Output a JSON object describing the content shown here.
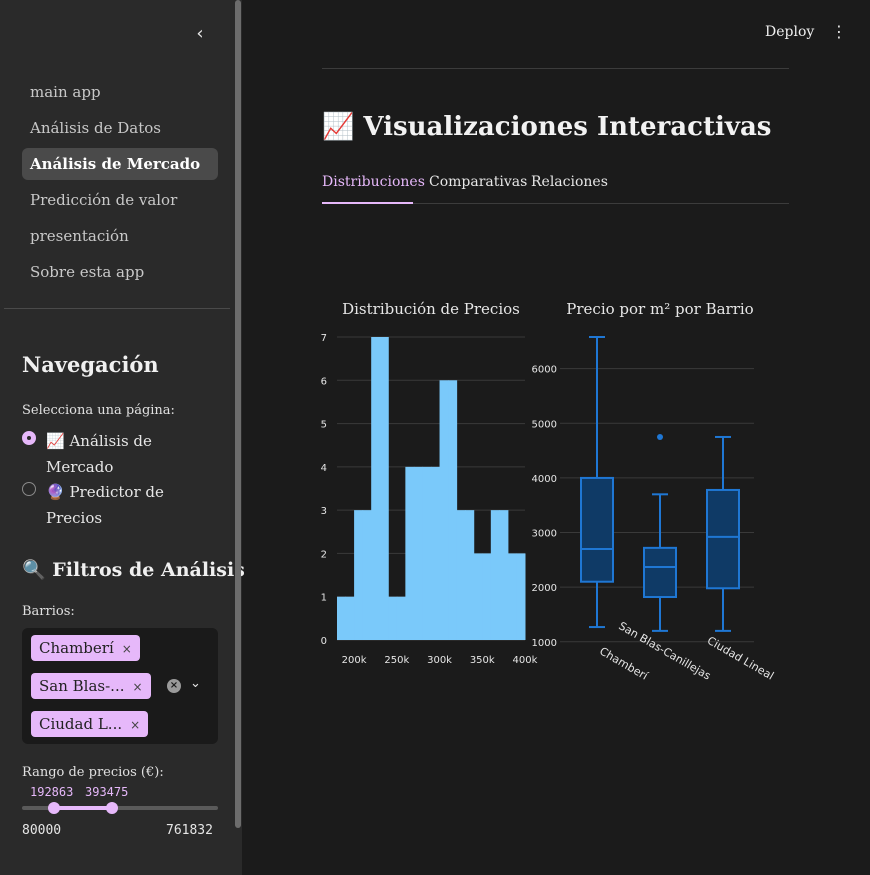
{
  "sidebar": {
    "collapse_icon": "chevron-left-icon",
    "collapse_glyph": "‹",
    "nav_links": [
      {
        "label": "main app"
      },
      {
        "label": "Análisis de Datos"
      },
      {
        "label": "Análisis de Mercado",
        "active": true
      },
      {
        "label": "Predicción de valor"
      },
      {
        "label": "presentación"
      },
      {
        "label": "Sobre esta app"
      }
    ],
    "nav_heading": "Navegación",
    "radio_label": "Selecciona una página:",
    "radio_options": [
      {
        "label": "📈 Análisis de Mercado",
        "selected": true
      },
      {
        "label": "🔮 Predictor de Precios",
        "selected": false
      }
    ],
    "filters_heading": "🔍 Filtros de Análisis",
    "barrios_label": "Barrios:",
    "barrios_tags": [
      "Chamberí",
      "San Blas-...",
      "Ciudad L..."
    ],
    "tag_remove_glyph": "×",
    "clear_glyph": "×",
    "dropdown_glyph": "⌄",
    "price_label": "Rango de precios (€):",
    "price_low": "192863",
    "price_high": "393475",
    "price_min": "80000",
    "price_max": "761832",
    "slider_low_fraction": 0.1655,
    "slider_high_fraction": 0.4597
  },
  "header": {
    "deploy_label": "Deploy",
    "menu_glyph": "⋮"
  },
  "main": {
    "title": "📈 Visualizaciones Interactivas",
    "tabs": [
      {
        "label": "Distribuciones",
        "active": true
      },
      {
        "label": "Comparativas"
      },
      {
        "label": "Relaciones"
      }
    ]
  },
  "colors": {
    "accent": "#e6b8fa",
    "histogram_fill": "#7ac9fa",
    "box_line": "#1f77d4",
    "box_fill": "#0f3a66"
  },
  "chart_data": [
    {
      "type": "bar",
      "title": "Distribución de Precios",
      "bin_edges": [
        180000,
        190000,
        200000,
        210000,
        220000,
        230000,
        240000,
        250000,
        260000,
        270000,
        280000,
        290000,
        300000,
        310000,
        320000,
        330000,
        340000,
        350000,
        360000,
        370000,
        380000,
        390000,
        400000
      ],
      "values": [
        1,
        1,
        3,
        3,
        7,
        7,
        1,
        1,
        4,
        4,
        4,
        4,
        6,
        6,
        3,
        3,
        2,
        2,
        3,
        3,
        2,
        2
      ],
      "x_tick_labels": [
        "200k",
        "250k",
        "300k",
        "350k",
        "400k"
      ],
      "x_ticks": [
        200000,
        250000,
        300000,
        350000,
        400000
      ],
      "y_ticks": [
        0,
        1,
        2,
        3,
        4,
        5,
        6,
        7
      ],
      "ylim": [
        0,
        7
      ],
      "xlim": [
        180000,
        400000
      ],
      "grid": true
    },
    {
      "type": "box",
      "title": "Precio por m² por Barrio",
      "categories": [
        "Chamberí",
        "San Blas-Canillejas",
        "Ciudad Lineal"
      ],
      "boxes": [
        {
          "min": 1270,
          "q1": 2100,
          "median": 2700,
          "q3": 4000,
          "max": 6580,
          "outliers": []
        },
        {
          "min": 1200,
          "q1": 1820,
          "median": 2370,
          "q3": 2720,
          "max": 3700,
          "outliers": [
            4750
          ]
        },
        {
          "min": 1200,
          "q1": 1980,
          "median": 2920,
          "q3": 3780,
          "max": 4750,
          "outliers": []
        }
      ],
      "y_ticks": [
        1000,
        2000,
        3000,
        4000,
        5000,
        6000
      ],
      "ylim": [
        850,
        6580
      ],
      "grid": true
    }
  ]
}
